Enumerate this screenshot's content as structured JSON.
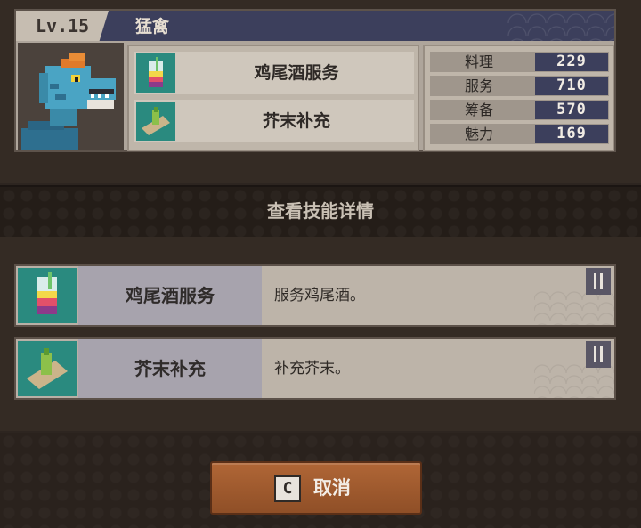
{
  "character": {
    "level_label": "Lv.15",
    "name": "猛禽"
  },
  "skills_preview": [
    {
      "label": "鸡尾酒服务",
      "icon": "cocktail-icon"
    },
    {
      "label": "芥末补充",
      "icon": "wasabi-icon"
    }
  ],
  "stats": [
    {
      "label": "料理",
      "value": "229"
    },
    {
      "label": "服务",
      "value": "710"
    },
    {
      "label": "筹备",
      "value": "570"
    },
    {
      "label": "魅力",
      "value": "169"
    }
  ],
  "section": {
    "title": "查看技能详情"
  },
  "skill_details": [
    {
      "name": "鸡尾酒服务",
      "desc": "服务鸡尾酒。",
      "icon": "cocktail-icon",
      "type_icon": "utensils-icon"
    },
    {
      "name": "芥末补充",
      "desc": "补充芥末。",
      "icon": "wasabi-icon",
      "type_icon": "utensils-icon"
    }
  ],
  "cancel": {
    "key": "C",
    "label": "取消"
  },
  "colors": {
    "accent_teal": "#2a8a7f",
    "header_navy": "#3c3f5c",
    "button_orange": "#a65d30"
  }
}
